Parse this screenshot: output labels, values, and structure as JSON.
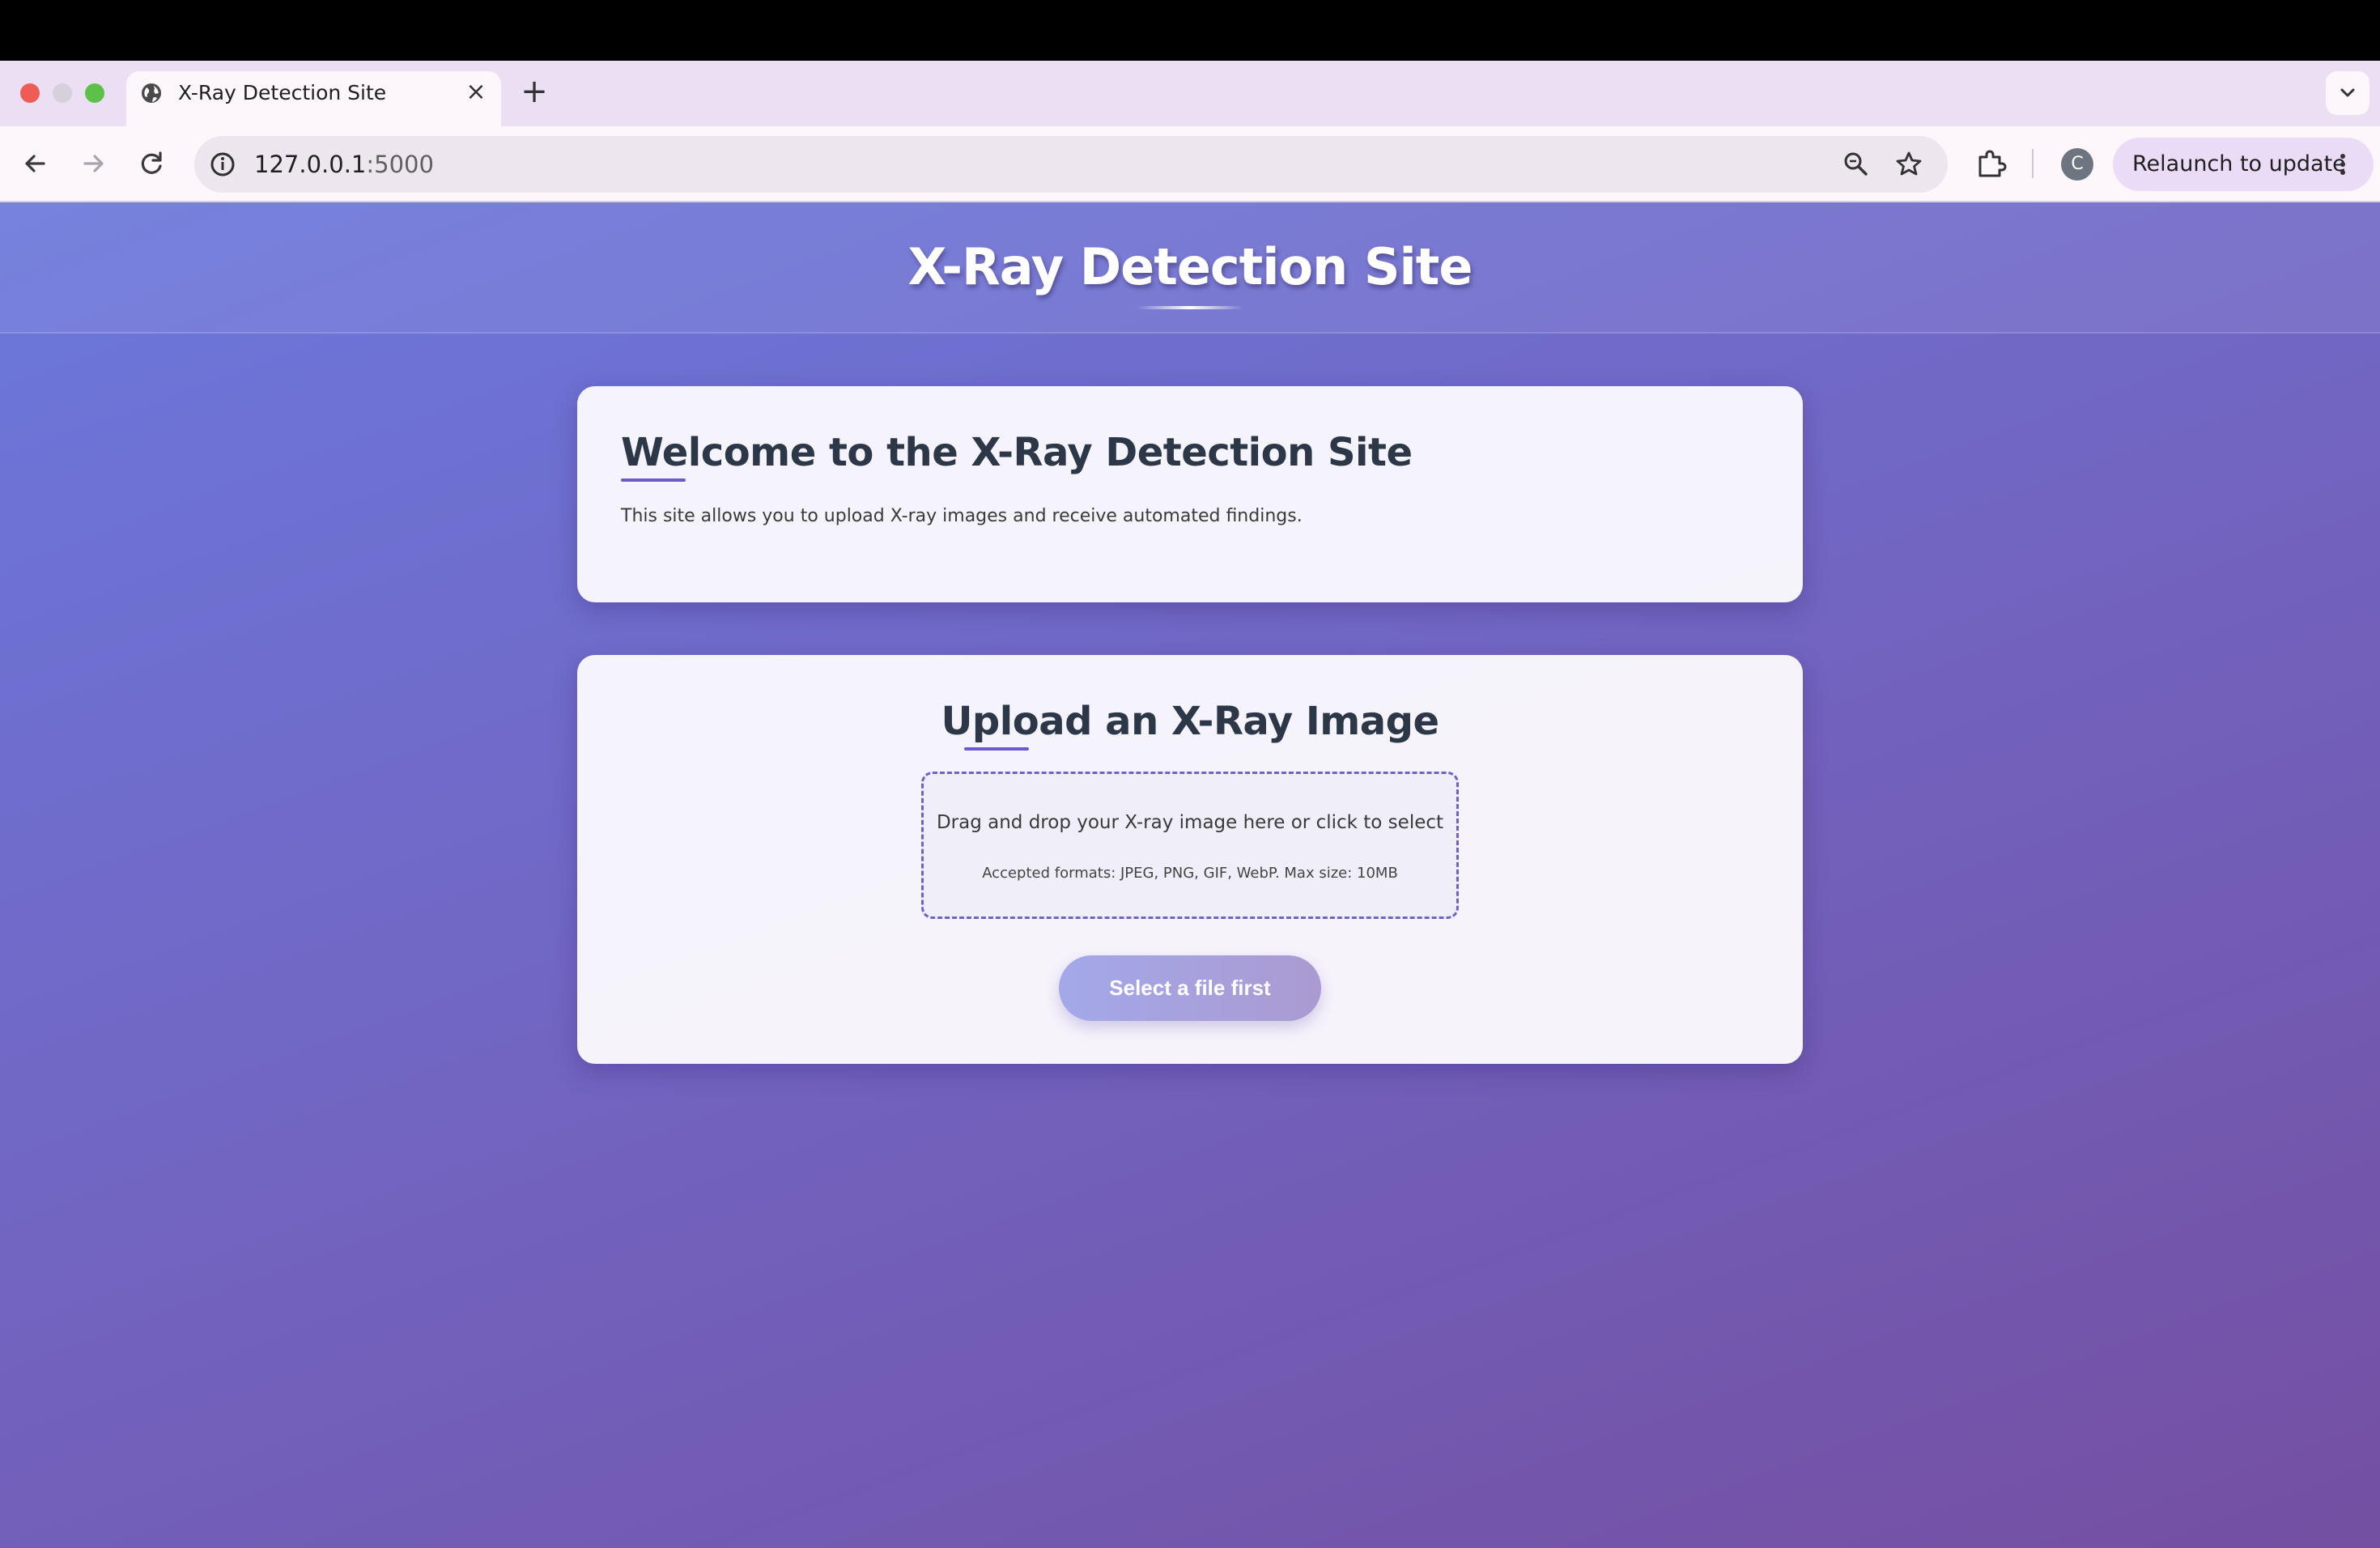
{
  "browser": {
    "tab_title": "X-Ray Detection Site",
    "tab_close": "×",
    "new_tab": "+",
    "url_host": "127.0.0.1",
    "url_port": ":5000",
    "avatar_initial": "C",
    "relaunch_label": "Relaunch to update"
  },
  "page": {
    "site_title": "X-Ray Detection Site",
    "welcome": {
      "heading": "Welcome to the X-Ray Detection Site",
      "text": "This site allows you to upload X-ray images and receive automated findings."
    },
    "upload": {
      "heading": "Upload an X-Ray Image",
      "dropzone_text": "Drag and drop your X-ray image here or click to select",
      "dropzone_subtext": "Accepted formats: JPEG, PNG, GIF, WebP. Max size: 10MB",
      "button_label": "Select a file first"
    }
  },
  "colors": {
    "page_gradient_start": "#6b78dc",
    "page_gradient_end": "#744fa2",
    "heading_text": "#2c3848",
    "accent": "#6a5acd"
  },
  "icons": {
    "tab_favicon": "globe-icon",
    "back": "back-arrow-icon",
    "forward": "forward-arrow-icon",
    "reload": "reload-icon",
    "site_info": "info-icon",
    "zoom": "zoom-icon",
    "bookmark": "star-icon",
    "extensions": "puzzle-icon",
    "menu": "kebab-menu-icon",
    "tab_search": "chevron-down-icon"
  }
}
